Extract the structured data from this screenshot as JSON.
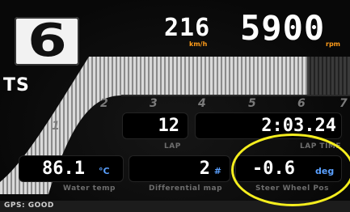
{
  "gear": {
    "value": "6"
  },
  "mode": {
    "label": "TS"
  },
  "speed": {
    "value": "216",
    "unit": "km/h"
  },
  "rpm": {
    "value": "5900",
    "unit": "rpm"
  },
  "shift_markers": [
    "1",
    "2",
    "3",
    "4",
    "5",
    "6",
    "7"
  ],
  "lap": {
    "value": "12",
    "label": "LAP"
  },
  "lap_time": {
    "value": "2:03.24",
    "label": "LAP TIME"
  },
  "water_temp": {
    "value": "86.1",
    "unit": "°C",
    "label": "Water temp"
  },
  "diff_map": {
    "value": "2",
    "unit": "#",
    "label": "Differential map"
  },
  "steer": {
    "value": "-0.6",
    "unit": "deg",
    "label": "Steer Wheel Pos"
  },
  "gps": {
    "label": "GPS: GOOD"
  },
  "colors": {
    "accent_orange": "#ff9c1a",
    "unit_blue": "#5aa0ff",
    "highlight_yellow": "#f5ee1e"
  }
}
